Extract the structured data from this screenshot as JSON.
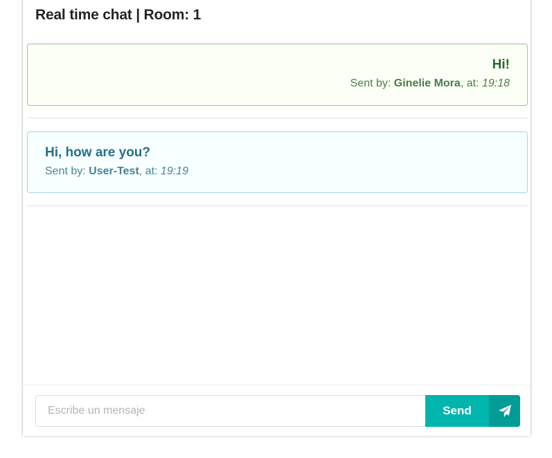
{
  "header": {
    "title": "Real time chat | Room: 1"
  },
  "messages": [
    {
      "text": "Hi!",
      "sent_by_label": "Sent by:",
      "sender": "Ginelie Mora",
      "at_label": ", at:",
      "time": "19:18",
      "own": true,
      "colors": {
        "background": "#fcfff5",
        "border": "#a3c293",
        "text": "#2c662d"
      }
    },
    {
      "text": "Hi, how are you?",
      "sent_by_label": "Sent by:",
      "sender": "User-Test",
      "at_label": ", at:",
      "time": "19:19",
      "own": false,
      "colors": {
        "background": "#f8ffff",
        "border": "#a9d5de",
        "text": "#276f86"
      }
    }
  ],
  "composer": {
    "placeholder": "Escribe un mensaje",
    "value": "",
    "send_label": "Send",
    "send_icon": "paper-plane-icon",
    "accent": "#00b5ad"
  }
}
